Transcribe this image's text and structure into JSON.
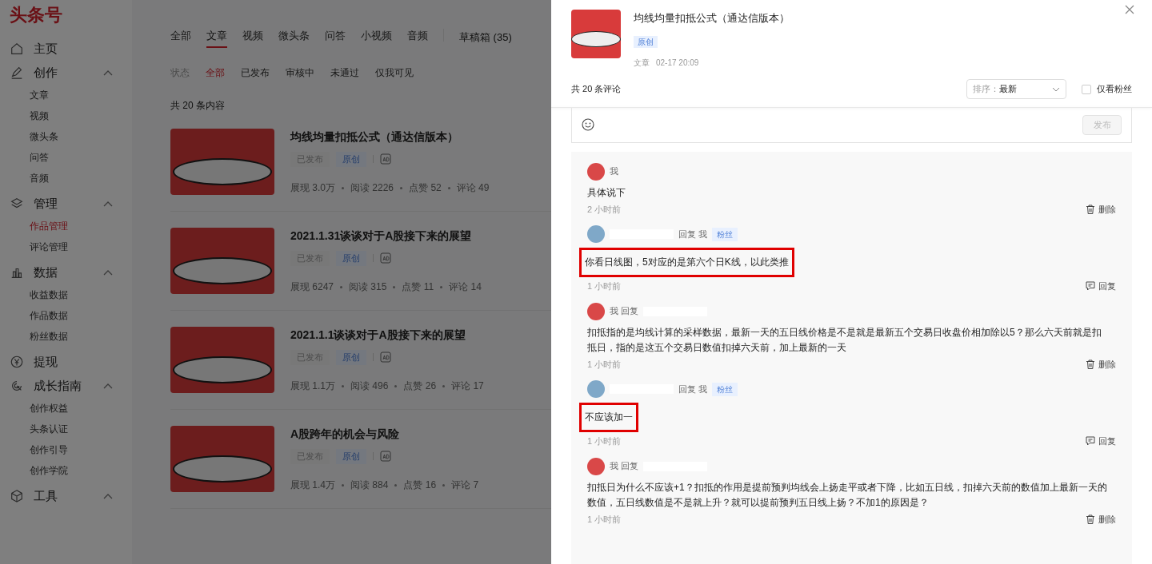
{
  "logo": "头条号",
  "sidebar": {
    "items": [
      {
        "label": "主页"
      },
      {
        "label": "创作",
        "expanded": true,
        "children": [
          {
            "label": "文章",
            "selected": false
          },
          {
            "label": "视频",
            "selected": false
          },
          {
            "label": "微头条",
            "selected": false
          },
          {
            "label": "问答",
            "selected": false
          },
          {
            "label": "音频",
            "selected": false
          }
        ]
      },
      {
        "label": "管理",
        "expanded": true,
        "children": [
          {
            "label": "作品管理",
            "selected": true
          },
          {
            "label": "评论管理",
            "selected": false
          }
        ]
      },
      {
        "label": "数据",
        "expanded": true,
        "children": [
          {
            "label": "收益数据",
            "selected": false
          },
          {
            "label": "作品数据",
            "selected": false
          },
          {
            "label": "粉丝数据",
            "selected": false
          }
        ]
      },
      {
        "label": "提现"
      },
      {
        "label": "成长指南",
        "expanded": true,
        "children": [
          {
            "label": "创作权益",
            "selected": false
          },
          {
            "label": "头条认证",
            "selected": false
          },
          {
            "label": "创作引导",
            "selected": false
          },
          {
            "label": "创作学院",
            "selected": false
          }
        ]
      },
      {
        "label": "工具",
        "expanded": true
      }
    ]
  },
  "content_tabs": [
    {
      "label": "全部",
      "selected": false
    },
    {
      "label": "文章",
      "selected": true
    },
    {
      "label": "视频",
      "selected": false
    },
    {
      "label": "微头条",
      "selected": false
    },
    {
      "label": "问答",
      "selected": false
    },
    {
      "label": "小视频",
      "selected": false
    },
    {
      "label": "音频",
      "selected": false
    }
  ],
  "drafts": "草稿箱 (35)",
  "status_filter": {
    "label": "状态",
    "options": [
      {
        "label": "全部",
        "selected": true
      },
      {
        "label": "已发布",
        "selected": false
      },
      {
        "label": "审核中",
        "selected": false
      },
      {
        "label": "未通过",
        "selected": false
      },
      {
        "label": "仅我可见",
        "selected": false
      }
    ]
  },
  "total": "共 20 条内容",
  "articles": [
    {
      "title": "均线均量扣抵公式（通达信版本）",
      "status": "已发布",
      "tag": "原创",
      "stats": [
        "展现 3.0万",
        "阅读 2226",
        "点赞 52",
        "评论 49"
      ]
    },
    {
      "title": "2021.1.31谈谈对于A股接下来的展望",
      "status": "已发布",
      "tag": "原创",
      "stats": [
        "展现 6247",
        "阅读 315",
        "点赞 11",
        "评论 14"
      ]
    },
    {
      "title": "2021.1.1谈谈对于A股接下来的展望",
      "status": "已发布",
      "tag": "原创",
      "stats": [
        "展现 1.1万",
        "阅读 496",
        "点赞 26",
        "评论 17"
      ]
    },
    {
      "title": "A股跨年的机会与风险",
      "status": "已发布",
      "tag": "原创",
      "stats": [
        "展现 1.4万",
        "阅读 884",
        "点赞 16",
        "评论 7"
      ]
    }
  ],
  "drawer": {
    "title": "均线均量扣抵公式（通达信版本）",
    "tag": "原创",
    "type": "文章",
    "date": "02-17 20:09",
    "count": "共 20 条评论",
    "sort": {
      "label": "排序：",
      "value": "最新"
    },
    "fans_only": {
      "label": "仅看粉丝",
      "checked": false
    },
    "publish": "发布",
    "comments": [
      {
        "kind": "own",
        "label": "我",
        "text": "具体说下",
        "time": "2 小时前",
        "action": "删除",
        "highlighted": false
      },
      {
        "kind": "fan",
        "label": "回复 我",
        "fan_badge": "粉丝",
        "text": "你看日线图，5对应的是第六个日K线，以此类推",
        "time": "1 小时前",
        "action": "回复",
        "highlighted": true
      },
      {
        "kind": "own",
        "label": "我 回复",
        "text": "扣抵指的是均线计算的采样数据，最新一天的五日线价格是不是就是最新五个交易日收盘价相加除以5？那么六天前就是扣抵日，指的是这五个交易日数值扣掉六天前，加上最新的一天",
        "time": "1 小时前",
        "action": "删除",
        "highlighted": false
      },
      {
        "kind": "fan",
        "label": "回复 我",
        "fan_badge": "粉丝",
        "text": "不应该加一",
        "time": "1 小时前",
        "action": "回复",
        "highlighted": true
      },
      {
        "kind": "own",
        "label": "我 回复",
        "text": "扣抵日为什么不应该+1？扣抵的作用是提前预判均线会上扬走平或者下降，比如五日线，扣掉六天前的数值加上最新一天的数值，五日线数值是不是就上升？就可以提前预判五日线上扬？不加1的原因是？",
        "time": "1 小时前",
        "action": "删除",
        "highlighted": false
      }
    ]
  }
}
